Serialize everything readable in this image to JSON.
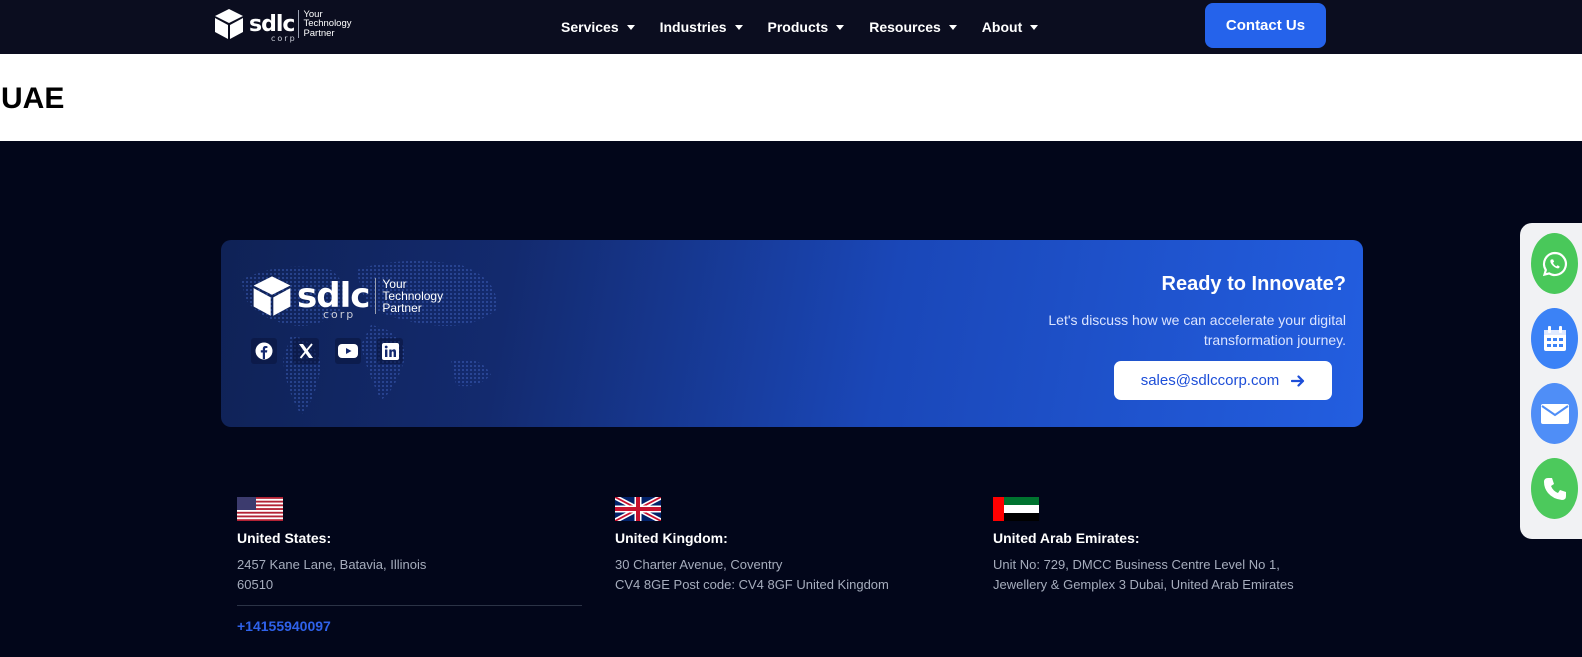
{
  "header": {
    "logo": {
      "wordmark": "sdlc",
      "sub": "corp",
      "tagline_lines": [
        "Your",
        "Technology",
        "Partner"
      ]
    },
    "nav": [
      {
        "label": "Services"
      },
      {
        "label": "Industries"
      },
      {
        "label": "Products"
      },
      {
        "label": "Resources"
      },
      {
        "label": "About"
      }
    ],
    "contact_label": "Contact Us"
  },
  "page": {
    "title": "UAE"
  },
  "banner": {
    "logo": {
      "wordmark": "sdlc",
      "sub": "corp",
      "tagline_lines": [
        "Your",
        "Technology",
        "Partner"
      ]
    },
    "social_icons": [
      "facebook-icon",
      "x-icon",
      "youtube-icon",
      "linkedin-icon"
    ],
    "title": "Ready to Innovate?",
    "subtitle": "Let's discuss how we can accelerate your digital transformation journey.",
    "email": "sales@sdlccorp.com"
  },
  "offices": [
    {
      "country": "United States:",
      "address_lines": [
        "2457 Kane Lane, Batavia, Illinois",
        "60510"
      ],
      "phone": "+14155940097",
      "flag": "us-flag-icon"
    },
    {
      "country": "United Kingdom:",
      "address_lines": [
        "30 Charter Avenue, Coventry",
        "CV4 8GE Post code: CV4 8GF United Kingdom"
      ],
      "flag": "uk-flag-icon"
    },
    {
      "country": "United Arab Emirates:",
      "address_lines": [
        "Unit No: 729, DMCC Business Centre Level No 1,",
        "Jewellery & Gemplex 3 Dubai, United Arab Emirates"
      ],
      "flag": "uae-flag-icon"
    }
  ],
  "floating_actions": [
    "whatsapp-icon",
    "calendar-icon",
    "mail-icon",
    "phone-icon"
  ],
  "colors": {
    "accent": "#2563eb",
    "header_bg": "#0b0d1f",
    "footer_bg": "#02061a",
    "whatsapp": "#49c85a",
    "calendar": "#3b82f6",
    "mail": "#4f8ef7",
    "phone": "#4cc95c"
  }
}
